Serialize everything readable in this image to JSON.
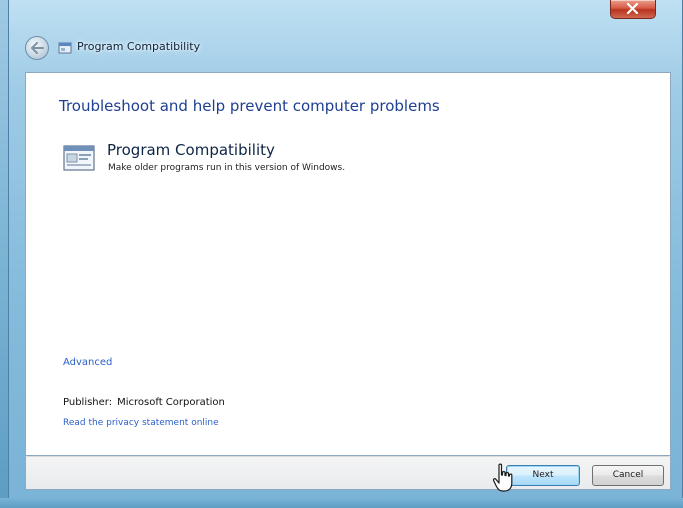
{
  "window": {
    "title": "Program Compatibility"
  },
  "titlebar": {
    "back_icon": "back-arrow-icon",
    "close_icon": "close-icon"
  },
  "content": {
    "heading": "Troubleshoot and help prevent computer problems",
    "program": {
      "icon": "program-compatibility-icon",
      "title": "Program Compatibility",
      "description": "Make older programs run in this version of Windows."
    },
    "advanced_link": "Advanced",
    "publisher_label": "Publisher:",
    "publisher_value": "Microsoft Corporation",
    "privacy_link": "Read the privacy statement online"
  },
  "footer": {
    "next_label": "Next",
    "cancel_label": "Cancel"
  },
  "colors": {
    "heading": "#1e3f92",
    "link": "#2c5fc9",
    "frame": "#86bcdc"
  }
}
